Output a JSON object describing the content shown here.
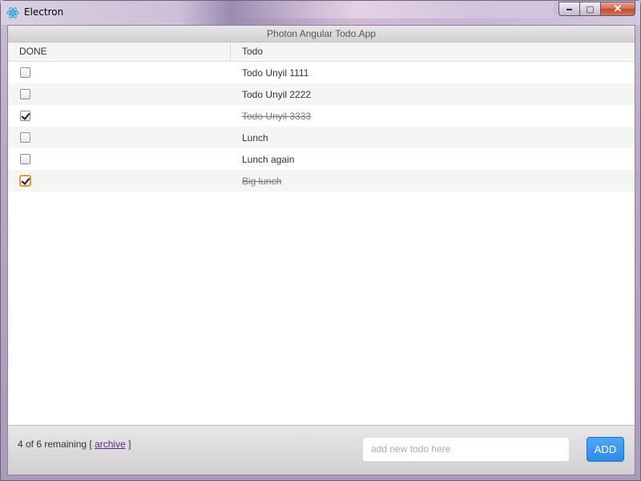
{
  "window": {
    "title": "Electron",
    "controls": {
      "minimize": "▬",
      "maximize": "▢",
      "close": "✕"
    }
  },
  "app": {
    "header": "Photon Angular Todo.App",
    "columns": {
      "done": "DONE",
      "todo": "Todo"
    },
    "todos": [
      {
        "text": "Todo Unyil 1111",
        "done": false
      },
      {
        "text": "Todo Unyil 2222",
        "done": false
      },
      {
        "text": "Todo Unyil 3333",
        "done": true
      },
      {
        "text": "Lunch",
        "done": false
      },
      {
        "text": "Lunch again",
        "done": false
      },
      {
        "text": "Big lunch",
        "done": true
      }
    ],
    "footer": {
      "remaining_text": "4 of 6 remaining [",
      "archive_link": "archive",
      "remaining_close": "]",
      "new_todo_placeholder": "add new todo here",
      "add_label": "ADD"
    }
  },
  "colors": {
    "accent": "#2f89e5",
    "link": "#5b2a86"
  }
}
